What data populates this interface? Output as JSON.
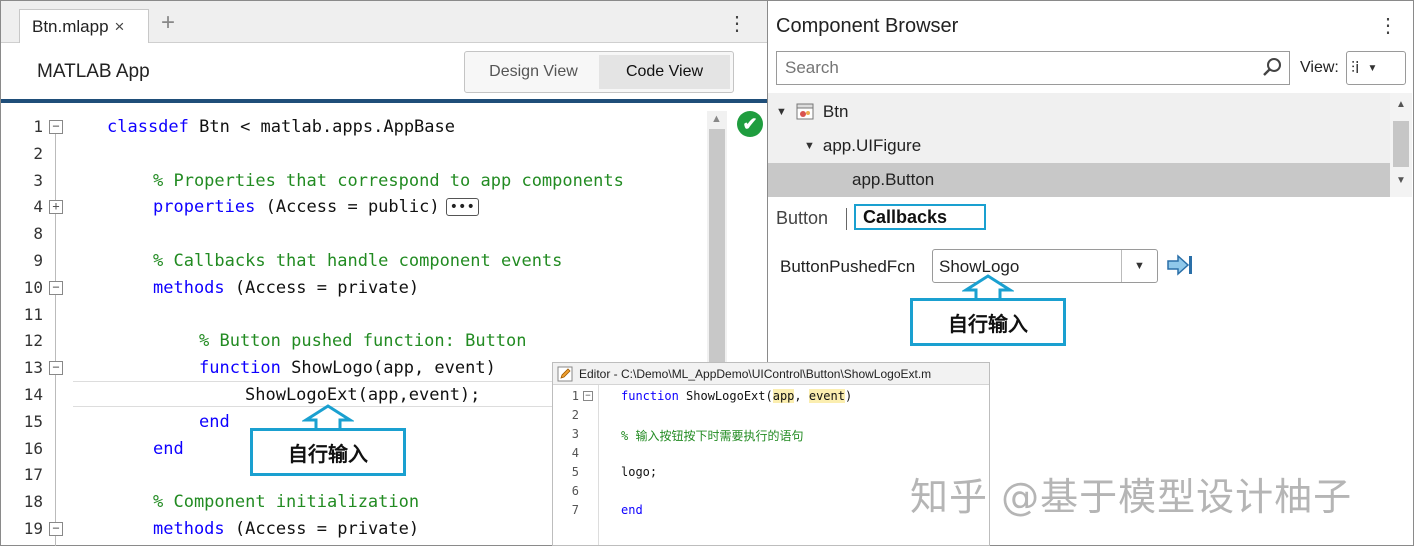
{
  "editor_tab": {
    "filename": "Btn.mlapp",
    "close": "×",
    "add": "+"
  },
  "left_menu": "⋮",
  "app_title": "MATLAB App",
  "view_toggle": {
    "design": "Design View",
    "code": "Code View"
  },
  "code_lines": [
    {
      "num": "1",
      "fold": "−",
      "indent": 0,
      "parts": [
        [
          "kw",
          "classdef"
        ],
        [
          "tx",
          " Btn < matlab.apps.AppBase"
        ]
      ]
    },
    {
      "num": "2",
      "fold": "",
      "indent": 0,
      "parts": []
    },
    {
      "num": "3",
      "fold": "",
      "indent": 1,
      "parts": [
        [
          "cm",
          "% Properties that correspond to app components"
        ]
      ]
    },
    {
      "num": "4",
      "fold": "+",
      "indent": 1,
      "parts": [
        [
          "kw",
          "properties"
        ],
        [
          "tx",
          " (Access = public)"
        ]
      ]
    },
    {
      "num": "8",
      "fold": "",
      "indent": 0,
      "parts": []
    },
    {
      "num": "9",
      "fold": "",
      "indent": 1,
      "parts": [
        [
          "cm",
          "% Callbacks that handle component events"
        ]
      ]
    },
    {
      "num": "10",
      "fold": "−",
      "indent": 1,
      "parts": [
        [
          "kw",
          "methods"
        ],
        [
          "tx",
          " (Access = private)"
        ]
      ]
    },
    {
      "num": "11",
      "fold": "",
      "indent": 0,
      "parts": []
    },
    {
      "num": "12",
      "fold": "",
      "indent": 2,
      "parts": [
        [
          "cm",
          "% Button pushed function: Button"
        ]
      ]
    },
    {
      "num": "13",
      "fold": "−",
      "indent": 2,
      "parts": [
        [
          "kw",
          "function"
        ],
        [
          "tx",
          " ShowLogo(app, event)"
        ]
      ]
    },
    {
      "num": "14",
      "fold": "",
      "indent": 3,
      "parts": [
        [
          "tx",
          "ShowLogoExt(app,event);"
        ]
      ]
    },
    {
      "num": "15",
      "fold": "",
      "indent": 2,
      "parts": [
        [
          "kw",
          "end"
        ]
      ]
    },
    {
      "num": "16",
      "fold": "",
      "indent": 1,
      "parts": [
        [
          "kw",
          "end"
        ]
      ]
    },
    {
      "num": "17",
      "fold": "",
      "indent": 0,
      "parts": []
    },
    {
      "num": "18",
      "fold": "",
      "indent": 1,
      "parts": [
        [
          "cm",
          "% Component initialization"
        ]
      ]
    },
    {
      "num": "19",
      "fold": "−",
      "indent": 1,
      "parts": [
        [
          "kw",
          "methods"
        ],
        [
          "tx",
          " (Access = private)"
        ]
      ]
    }
  ],
  "collapsed_marker": "•••",
  "status": {
    "ok_glyph": "✔",
    "color": "#1f9d3f"
  },
  "component_browser": {
    "title": "Component Browser",
    "menu": "⋮",
    "search_placeholder": "Search",
    "view_label": "View:",
    "view_glyph": "⫶ⅰ",
    "tree": [
      {
        "label": "Btn",
        "level": 0,
        "expander": "▼"
      },
      {
        "label": "app.UIFigure",
        "level": 1,
        "expander": "▼"
      },
      {
        "label": "app.Button",
        "level": 2,
        "expander": ""
      }
    ],
    "tabs": {
      "button": "Button",
      "callbacks": "Callbacks"
    },
    "callback_property": "ButtonPushedFcn",
    "callback_value": "ShowLogo",
    "dropdown_glyph": "▼"
  },
  "callouts": {
    "right": "自行输入",
    "left": "自行输入",
    "color": "#1aa0d0"
  },
  "external_editor": {
    "title": "Editor - C:\\Demo\\ML_AppDemo\\UIControl\\Button\\ShowLogoExt.m",
    "lines": [
      {
        "num": "1",
        "fold": "−",
        "parts": [
          [
            "kw",
            "function"
          ],
          [
            "tx",
            " ShowLogoExt("
          ],
          [
            "hl",
            "app"
          ],
          [
            "tx",
            ", "
          ],
          [
            "hl",
            "event"
          ],
          [
            "tx",
            ")"
          ]
        ]
      },
      {
        "num": "2",
        "fold": "",
        "parts": []
      },
      {
        "num": "3",
        "fold": "",
        "parts": [
          [
            "cm",
            "% 输入按钮按下时需要执行的语句"
          ]
        ]
      },
      {
        "num": "4",
        "fold": "",
        "parts": []
      },
      {
        "num": "5",
        "fold": "",
        "parts": [
          [
            "tx",
            "logo;"
          ]
        ]
      },
      {
        "num": "6",
        "fold": "",
        "parts": []
      },
      {
        "num": "7",
        "fold": "",
        "parts": [
          [
            "kw",
            "end"
          ]
        ]
      }
    ]
  },
  "watermark": "知乎 @基于模型设计柚子"
}
